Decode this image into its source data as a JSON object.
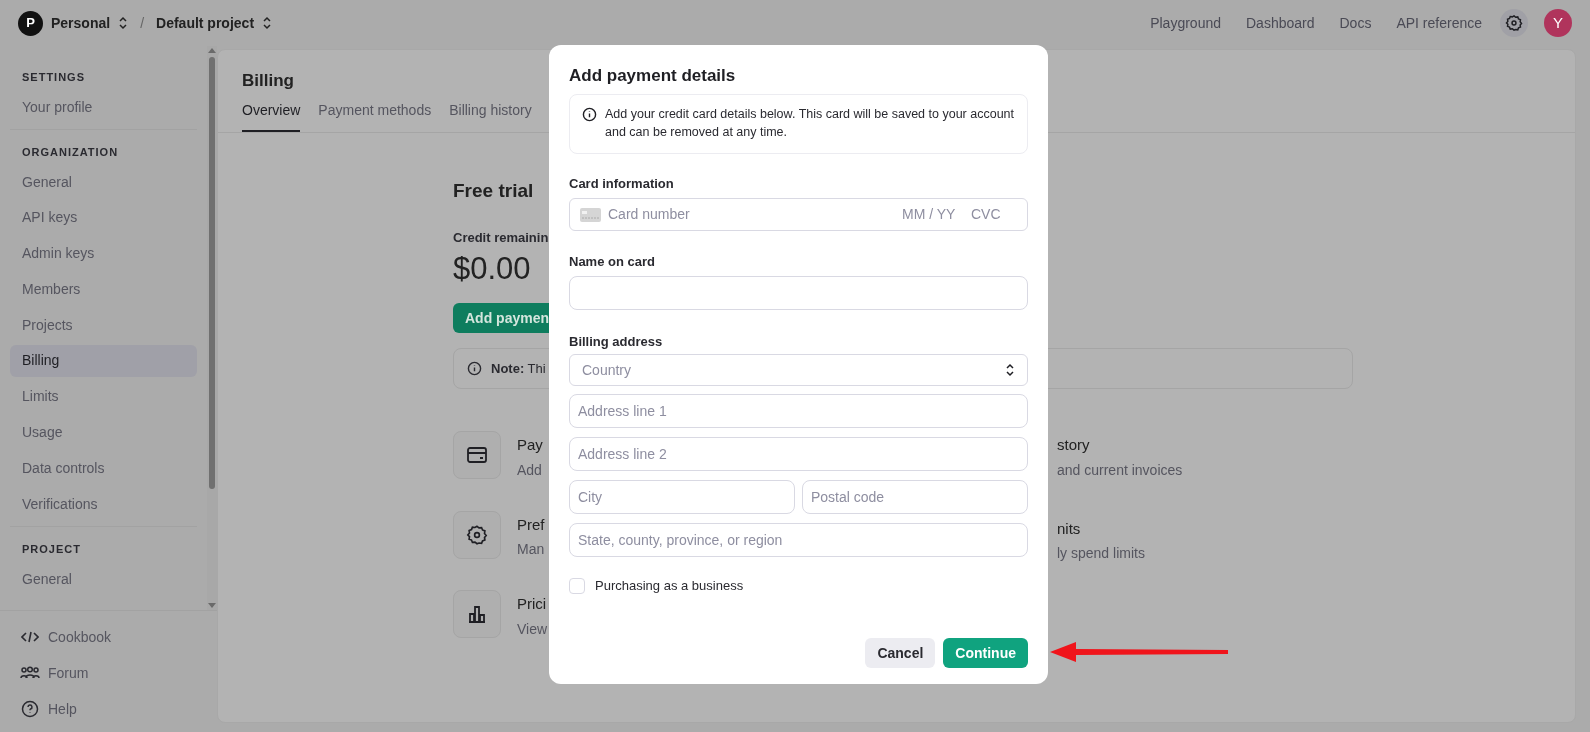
{
  "top_bar": {
    "org": {
      "initial": "P",
      "name": "Personal"
    },
    "separator": "/",
    "project": "Default project",
    "links": [
      "Playground",
      "Dashboard",
      "Docs",
      "API reference"
    ],
    "avatar": "Y"
  },
  "sidebar": {
    "sections": [
      {
        "heading": "SETTINGS",
        "items": [
          {
            "label": "Your profile",
            "selected": false
          }
        ]
      },
      {
        "heading": "ORGANIZATION",
        "items": [
          {
            "label": "General",
            "selected": false
          },
          {
            "label": "API keys",
            "selected": false
          },
          {
            "label": "Admin keys",
            "selected": false
          },
          {
            "label": "Members",
            "selected": false
          },
          {
            "label": "Projects",
            "selected": false
          },
          {
            "label": "Billing",
            "selected": true
          },
          {
            "label": "Limits",
            "selected": false
          },
          {
            "label": "Usage",
            "selected": false
          },
          {
            "label": "Data controls",
            "selected": false
          },
          {
            "label": "Verifications",
            "selected": false
          }
        ]
      },
      {
        "heading": "PROJECT",
        "items": [
          {
            "label": "General",
            "selected": false
          }
        ]
      }
    ],
    "footer_links": [
      {
        "kind": "code",
        "label": "Cookbook"
      },
      {
        "kind": "people",
        "label": "Forum"
      },
      {
        "kind": "help",
        "label": "Help"
      }
    ]
  },
  "main": {
    "title": "Billing",
    "tabs": [
      {
        "label": "Overview",
        "selected": true
      },
      {
        "label": "Payment methods",
        "selected": false
      },
      {
        "label": "Billing history",
        "selected": false
      }
    ],
    "plan_title": "Free trial",
    "credit_label": "Credit remainin",
    "credit_amount": "$0.00",
    "add_button": "Add paymen",
    "note": "**Note:** Thi",
    "cards": [
      {
        "kind": "card",
        "title": "Pay",
        "description": "Add"
      },
      {
        "kind": "gear",
        "title": "Pref",
        "description": "Man"
      },
      {
        "kind": "chart",
        "title": "Prici",
        "description": "View"
      }
    ],
    "right_cards": [
      {
        "title": "story",
        "description": "and current invoices"
      },
      {
        "title": "nits",
        "description": "ly spend limits"
      }
    ]
  },
  "dialog": {
    "title": "Add payment details",
    "info": "Add your credit card details below. This card will be saved to your account and can be removed at any time.",
    "card_label": "Card information",
    "card_field": {
      "placeholder": "Card number",
      "expiry_placeholder": "MM / YY",
      "cvc_placeholder": "CVC"
    },
    "name_label": "Name on card",
    "billing_label": "Billing address",
    "country": {
      "placeholder": "Country"
    },
    "address_rows": [
      [
        {
          "placeholder": "Address line 1"
        }
      ],
      [
        {
          "placeholder": "Address line 2"
        }
      ],
      [
        {
          "placeholder": "City"
        },
        {
          "placeholder": "Postal code"
        }
      ],
      [
        {
          "placeholder": "State, county, province, or region"
        }
      ]
    ],
    "business": {
      "label": "Purchasing as a business",
      "checked": false
    },
    "buttons": [
      {
        "label": "Cancel",
        "kind": "secondary"
      },
      {
        "label": "Continue",
        "kind": "primary"
      }
    ]
  }
}
